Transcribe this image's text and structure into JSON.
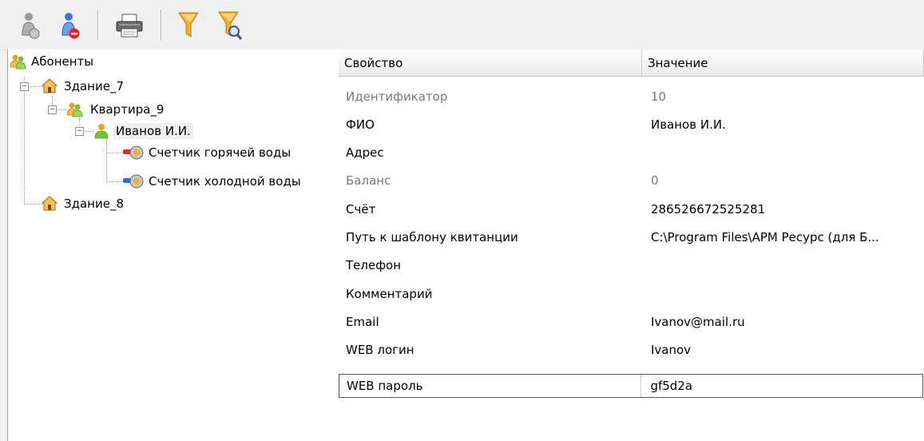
{
  "toolbar": {
    "buttons": [
      {
        "name": "add-user-button",
        "icon": "user-gray-icon"
      },
      {
        "name": "remove-user-button",
        "icon": "user-remove-icon"
      },
      {
        "name": "print-button",
        "icon": "printer-icon"
      },
      {
        "name": "filter-button",
        "icon": "funnel-icon"
      },
      {
        "name": "filter-search-button",
        "icon": "funnel-search-icon"
      }
    ]
  },
  "tree": {
    "root": "Абоненты",
    "building_7": "Здание_7",
    "apartment_9": "Квартира_9",
    "person": "Иванов И.И.",
    "hot_meter": "Счетчик горячей воды",
    "cold_meter": "Счетчик холодной воды",
    "building_8": "Здание_8"
  },
  "grid": {
    "header_property": "Свойство",
    "header_value": "Значение",
    "rows": [
      {
        "property": "Идентификатор",
        "value": "10"
      },
      {
        "property": "ФИО",
        "value": "Иванов И.И."
      },
      {
        "property": "Адрес",
        "value": ""
      },
      {
        "property": "Баланс",
        "value": "0"
      },
      {
        "property": "Счёт",
        "value": "286526672525281"
      },
      {
        "property": "Путь к шаблону квитанции",
        "value": "C:\\Program Files\\АРМ Ресурс (для Б..."
      },
      {
        "property": "Телефон",
        "value": ""
      },
      {
        "property": "Комментарий",
        "value": ""
      },
      {
        "property": "Email",
        "value": "Ivanov@mail.ru"
      },
      {
        "property": "WEB логин",
        "value": "Ivanov"
      },
      {
        "property": "WEB пароль",
        "value": "gf5d2a"
      }
    ]
  }
}
